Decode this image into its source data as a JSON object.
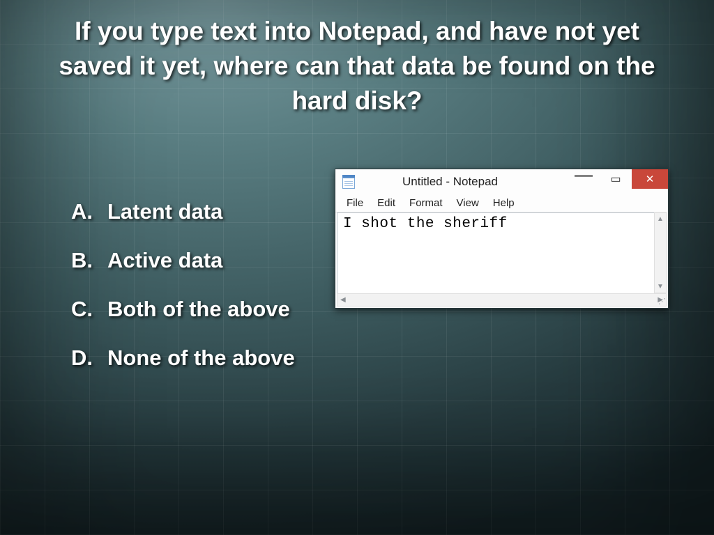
{
  "question": "If you type text into Notepad, and have not yet saved it yet, where can that data be found on the hard disk?",
  "answers": [
    {
      "letter": "A.",
      "text": "Latent data"
    },
    {
      "letter": "B.",
      "text": "Active data"
    },
    {
      "letter": "C.",
      "text": "Both of the above"
    },
    {
      "letter": "D.",
      "text": "None of the above"
    }
  ],
  "notepad": {
    "title": "Untitled - Notepad",
    "menu": {
      "file": "File",
      "edit": "Edit",
      "format": "Format",
      "view": "View",
      "help": "Help"
    },
    "content": "I shot the sheriff",
    "glyphs": {
      "minimize": "—",
      "maximize": "▭",
      "close": "✕",
      "up": "▲",
      "down": "▼",
      "left": "◀",
      "right": "▶",
      "grip": "⋰"
    }
  }
}
